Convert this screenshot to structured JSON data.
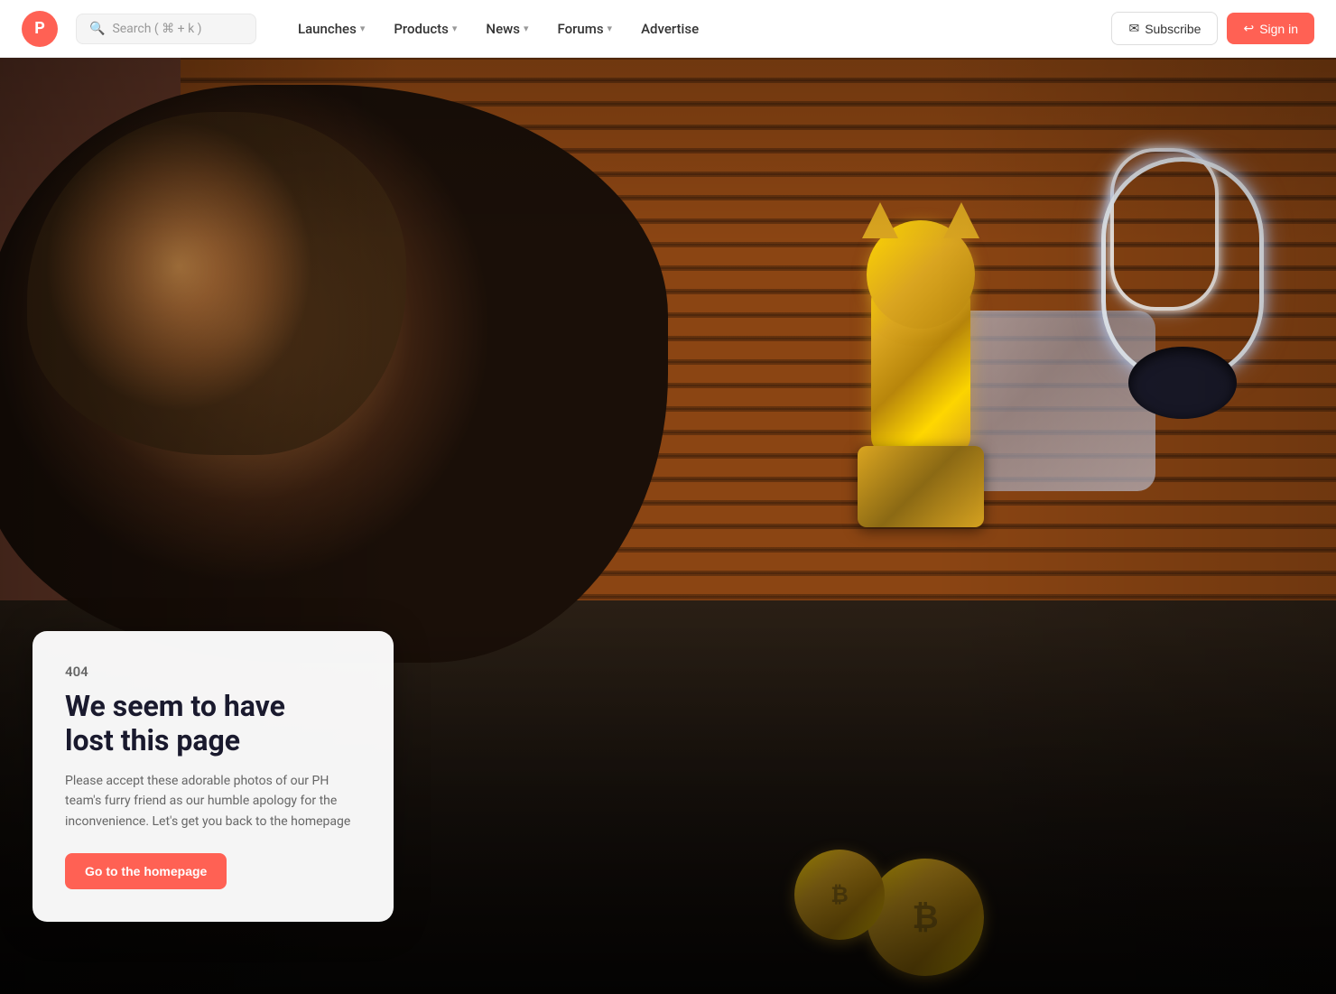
{
  "nav": {
    "logo_letter": "P",
    "search_placeholder": "Search ( ⌘ + k )",
    "links": [
      {
        "label": "Launches",
        "has_dropdown": true
      },
      {
        "label": "Products",
        "has_dropdown": true
      },
      {
        "label": "News",
        "has_dropdown": true
      },
      {
        "label": "Forums",
        "has_dropdown": true
      },
      {
        "label": "Advertise",
        "has_dropdown": false
      }
    ],
    "subscribe_label": "Subscribe",
    "signin_label": "Sign in"
  },
  "error": {
    "code": "404",
    "title_line1": "We seem to have",
    "title_line2": "lost this page",
    "description": "Please accept these adorable photos of our PH team's furry friend as our humble apology for the inconvenience. Let's get you back to the homepage",
    "cta_label": "Go to the homepage"
  },
  "icons": {
    "search": "🔍",
    "subscribe": "✉",
    "signin": "→",
    "chevron": "⌄",
    "bitcoin": "₿"
  }
}
